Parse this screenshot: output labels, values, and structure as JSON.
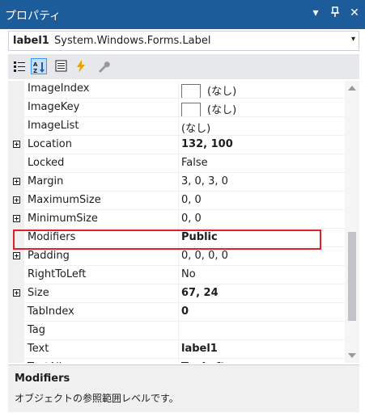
{
  "window": {
    "title": "プロパティ",
    "buttons": {
      "dropdown": "▾",
      "pin": "⊕",
      "close": "✕"
    }
  },
  "object_selector": {
    "name": "label1",
    "type": "System.Windows.Forms.Label",
    "arrow": "▾"
  },
  "toolbar": {
    "buttons": [
      "categorized-icon",
      "alphabetical-icon",
      "properties-icon",
      "events-icon",
      "property-pages-icon"
    ]
  },
  "properties": [
    {
      "name": "ImageIndex",
      "value": "(なし)",
      "swatch": true,
      "expandable": false,
      "bold": false
    },
    {
      "name": "ImageKey",
      "value": "(なし)",
      "swatch": true,
      "expandable": false,
      "bold": false
    },
    {
      "name": "ImageList",
      "value": "(なし)",
      "swatch": false,
      "expandable": false,
      "bold": false
    },
    {
      "name": "Location",
      "value": "132, 100",
      "swatch": false,
      "expandable": true,
      "bold": true
    },
    {
      "name": "Locked",
      "value": "False",
      "swatch": false,
      "expandable": false,
      "bold": false
    },
    {
      "name": "Margin",
      "value": "3, 0, 3, 0",
      "swatch": false,
      "expandable": true,
      "bold": false
    },
    {
      "name": "MaximumSize",
      "value": "0, 0",
      "swatch": false,
      "expandable": true,
      "bold": false
    },
    {
      "name": "MinimumSize",
      "value": "0, 0",
      "swatch": false,
      "expandable": true,
      "bold": false
    },
    {
      "name": "Modifiers",
      "value": "Public",
      "swatch": false,
      "expandable": false,
      "bold": true
    },
    {
      "name": "Padding",
      "value": "0, 0, 0, 0",
      "swatch": false,
      "expandable": true,
      "bold": false
    },
    {
      "name": "RightToLeft",
      "value": "No",
      "swatch": false,
      "expandable": false,
      "bold": false
    },
    {
      "name": "Size",
      "value": "67, 24",
      "swatch": false,
      "expandable": true,
      "bold": true
    },
    {
      "name": "TabIndex",
      "value": "0",
      "swatch": false,
      "expandable": false,
      "bold": true
    },
    {
      "name": "Tag",
      "value": "",
      "swatch": false,
      "expandable": false,
      "bold": false
    },
    {
      "name": "Text",
      "value": "label1",
      "swatch": false,
      "expandable": false,
      "bold": true
    },
    {
      "name": "TextAlign",
      "value": "TopLeft",
      "swatch": false,
      "expandable": false,
      "bold": true
    }
  ],
  "selected_property": "Modifiers",
  "description": {
    "title": "Modifiers",
    "text": "オブジェクトの参照範囲レベルです。"
  },
  "colors": {
    "titlebar": "#1c5c9a",
    "highlight_border": "#e0202a",
    "toolbar_bg": "#e7e8ec"
  }
}
